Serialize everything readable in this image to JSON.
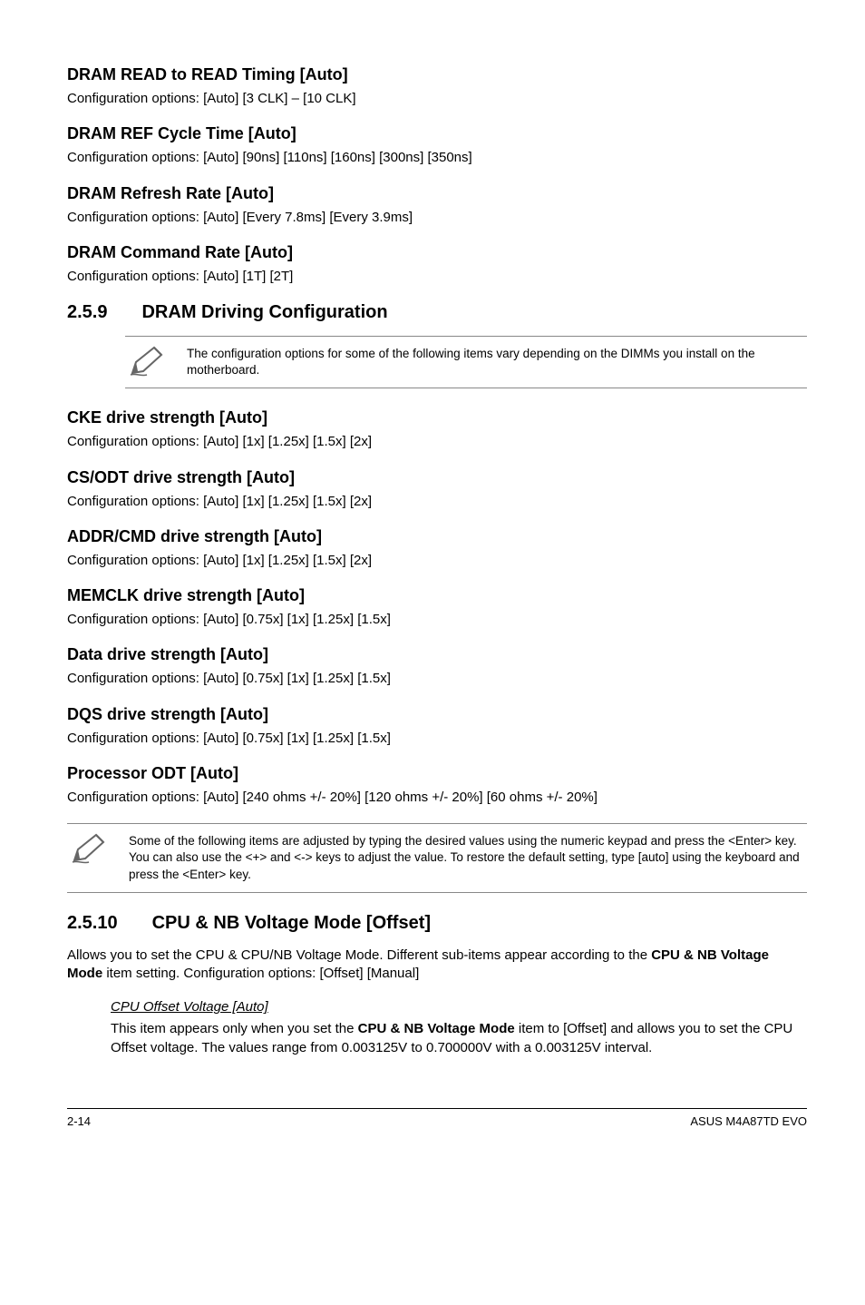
{
  "s1": {
    "title": "DRAM READ to READ Timing [Auto]",
    "body": "Configuration options: [Auto] [3 CLK] – [10 CLK]"
  },
  "s2": {
    "title": "DRAM REF Cycle Time [Auto]",
    "body": "Configuration options: [Auto] [90ns] [110ns] [160ns] [300ns] [350ns]"
  },
  "s3": {
    "title": "DRAM Refresh Rate [Auto]",
    "body": "Configuration options: [Auto] [Every 7.8ms] [Every 3.9ms]"
  },
  "s4": {
    "title": "DRAM Command Rate [Auto]",
    "body": "Configuration options: [Auto] [1T] [2T]"
  },
  "sec259": {
    "num": "2.5.9",
    "name": "DRAM Driving Configuration",
    "note": "The configuration options for some of the following items vary depending on the DIMMs you install on the motherboard."
  },
  "s5": {
    "title": "CKE drive strength [Auto]",
    "body": "Configuration options: [Auto] [1x] [1.25x] [1.5x] [2x]"
  },
  "s6": {
    "title": "CS/ODT drive strength [Auto]",
    "body": "Configuration options: [Auto] [1x] [1.25x] [1.5x] [2x]"
  },
  "s7": {
    "title": "ADDR/CMD drive strength [Auto]",
    "body": "Configuration options: [Auto] [1x] [1.25x] [1.5x] [2x]"
  },
  "s8": {
    "title": "MEMCLK drive strength [Auto]",
    "body": "Configuration options: [Auto] [0.75x] [1x] [1.25x] [1.5x]"
  },
  "s9": {
    "title": "Data drive strength [Auto]",
    "body": "Configuration options: [Auto] [0.75x] [1x] [1.25x] [1.5x]"
  },
  "s10": {
    "title": "DQS drive strength [Auto]",
    "body": "Configuration options: [Auto] [0.75x] [1x] [1.25x] [1.5x]"
  },
  "s11": {
    "title": "Processor ODT [Auto]",
    "body": "Configuration options: [Auto] [240 ohms +/- 20%] [120 ohms +/- 20%] [60 ohms +/- 20%]"
  },
  "note2": "Some of the following items are adjusted by typing the desired values using the numeric keypad and press the <Enter> key. You can also use the <+> and <-> keys to adjust the value. To restore the default setting, type [auto] using the keyboard and press the <Enter> key.",
  "sec2510": {
    "num": "2.5.10",
    "name": "CPU & NB Voltage Mode [Offset]",
    "body_pre": "Allows you to set the CPU & CPU/NB Voltage Mode. Different sub-items appear according to the ",
    "body_bold": "CPU & NB Voltage Mode",
    "body_post": " item setting. Configuration options: [Offset] [Manual]",
    "sub_title": "CPU Offset Voltage [Auto]",
    "sub_body_pre": "This item appears only when you set the ",
    "sub_body_bold": "CPU & NB Voltage Mode",
    "sub_body_post": " item to [Offset] and allows you to set the CPU Offset voltage. The values range from 0.003125V to 0.700000V with a 0.003125V interval."
  },
  "footer": {
    "left": "2-14",
    "right": "ASUS M4A87TD EVO"
  }
}
